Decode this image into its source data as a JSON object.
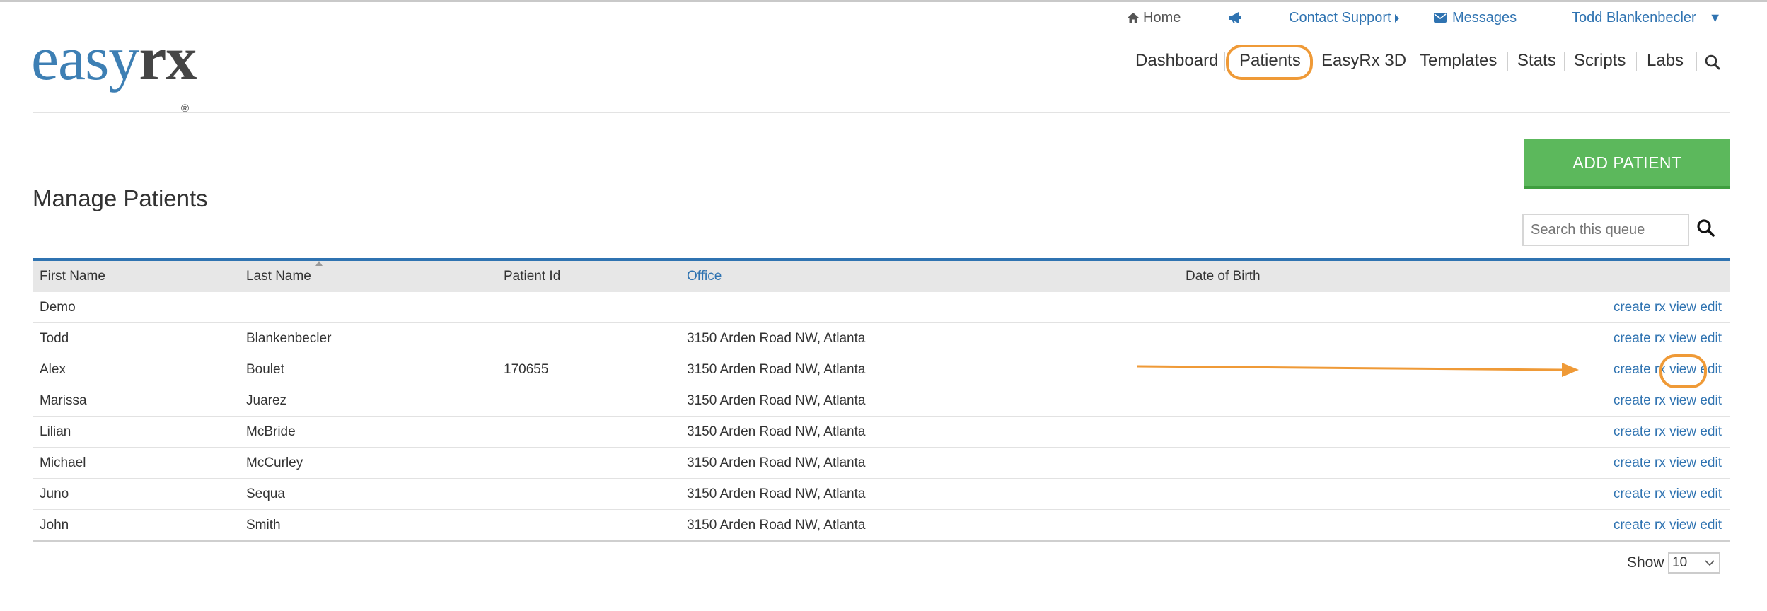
{
  "logo": {
    "part1": "easy",
    "part2": "rx",
    "reg": "®"
  },
  "toplinks": {
    "home": "Home",
    "contact_support": "Contact Support",
    "messages": "Messages",
    "user": "Todd Blankenbecler"
  },
  "nav": [
    "Dashboard",
    "Patients",
    "EasyRx 3D",
    "Templates",
    "Stats",
    "Scripts",
    "Labs"
  ],
  "page": {
    "title": "Manage Patients",
    "add_button": "ADD PATIENT",
    "search_placeholder": "Search this queue"
  },
  "table": {
    "headers": {
      "first_name": "First Name",
      "last_name": "Last Name",
      "patient_id": "Patient Id",
      "office": "Office",
      "dob": "Date of Birth"
    },
    "rows": [
      {
        "first": "Demo",
        "last": "",
        "id": "",
        "office": "",
        "dob": ""
      },
      {
        "first": "Todd",
        "last": "Blankenbecler",
        "id": "",
        "office": "3150 Arden Road NW, Atlanta",
        "dob": ""
      },
      {
        "first": "Alex",
        "last": "Boulet",
        "id": "170655",
        "office": "3150 Arden Road NW, Atlanta",
        "dob": ""
      },
      {
        "first": "Marissa",
        "last": "Juarez",
        "id": "",
        "office": "3150 Arden Road NW, Atlanta",
        "dob": ""
      },
      {
        "first": "Lilian",
        "last": "McBride",
        "id": "",
        "office": "3150 Arden Road NW, Atlanta",
        "dob": ""
      },
      {
        "first": "Michael",
        "last": "McCurley",
        "id": "",
        "office": "3150 Arden Road NW, Atlanta",
        "dob": ""
      },
      {
        "first": "Juno",
        "last": "Sequa",
        "id": "",
        "office": "3150 Arden Road NW, Atlanta",
        "dob": ""
      },
      {
        "first": "John",
        "last": "Smith",
        "id": "",
        "office": "3150 Arden Road NW, Atlanta",
        "dob": ""
      }
    ],
    "actions": {
      "create_rx": "create rx",
      "view": "view",
      "edit": "edit"
    }
  },
  "pagination": {
    "show_label": "Show",
    "page_size": "10"
  },
  "colors": {
    "link": "#2f73b1",
    "add_button": "#5cb85c",
    "annotation": "#ef9a37",
    "table_accent": "#2f73b1"
  },
  "icons": [
    "home-icon",
    "megaphone-icon",
    "envelope-icon",
    "caret-right-icon",
    "caret-down-icon",
    "search-icon",
    "sort-asc-icon",
    "chevron-down-icon"
  ]
}
